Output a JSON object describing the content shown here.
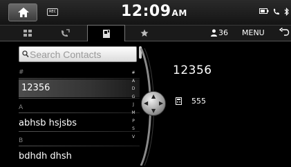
{
  "status": {
    "rec_label": "REC",
    "time": "12:09",
    "ampm": "AM"
  },
  "tabs": [
    {
      "name": "dial-pad",
      "active": false
    },
    {
      "name": "recent-calls",
      "active": false
    },
    {
      "name": "contacts",
      "active": true
    },
    {
      "name": "favorites",
      "active": false
    }
  ],
  "toolbar": {
    "contact_count": "36",
    "menu_label": "MENU"
  },
  "search": {
    "placeholder": "Search Contacts"
  },
  "contacts": {
    "groups": [
      {
        "letter": "#",
        "items": [
          "12356"
        ]
      },
      {
        "letter": "A",
        "items": [
          "abhsb hsjsbs"
        ]
      },
      {
        "letter": "B",
        "items": [
          "bdhdh dhsh"
        ]
      }
    ],
    "selected": "12356"
  },
  "index_letters": [
    "#",
    "A",
    "D",
    "G",
    "J",
    "M",
    "P",
    "S",
    "V"
  ],
  "detail": {
    "name": "12356",
    "phone": "555"
  },
  "colors": {
    "background": "#000000",
    "accent_light": "#ffffff",
    "header_text": "#888888"
  }
}
